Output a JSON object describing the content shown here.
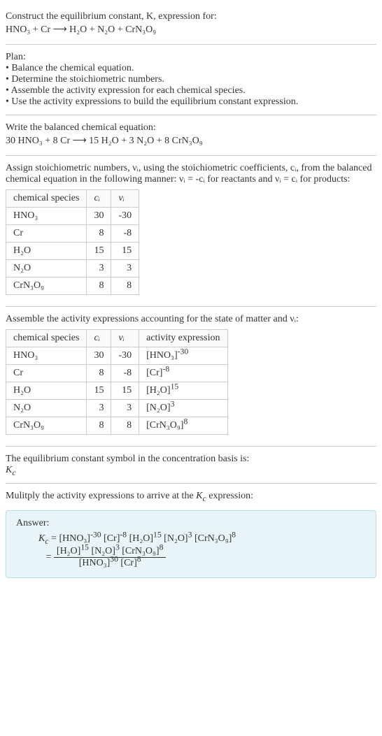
{
  "intro": {
    "line1": "Construct the equilibrium constant, K, expression for:",
    "equation": "HNO₃ + Cr ⟶ H₂O + N₂O + CrN₃O₉"
  },
  "plan": {
    "heading": "Plan:",
    "b1": "• Balance the chemical equation.",
    "b2": "• Determine the stoichiometric numbers.",
    "b3": "• Assemble the activity expression for each chemical species.",
    "b4": "• Use the activity expressions to build the equilibrium constant expression."
  },
  "balanced": {
    "heading": "Write the balanced chemical equation:",
    "equation": "30 HNO₃ + 8 Cr ⟶ 15 H₂O + 3 N₂O + 8 CrN₃O₉"
  },
  "assign": {
    "text": "Assign stoichiometric numbers, νᵢ, using the stoichiometric coefficients, cᵢ, from the balanced chemical equation in the following manner: νᵢ = -cᵢ for reactants and νᵢ = cᵢ for products:",
    "headers": {
      "h1": "chemical species",
      "h2": "cᵢ",
      "h3": "νᵢ"
    },
    "rows": [
      {
        "sp": "HNO₃",
        "c": "30",
        "v": "-30"
      },
      {
        "sp": "Cr",
        "c": "8",
        "v": "-8"
      },
      {
        "sp": "H₂O",
        "c": "15",
        "v": "15"
      },
      {
        "sp": "N₂O",
        "c": "3",
        "v": "3"
      },
      {
        "sp": "CrN₃O₉",
        "c": "8",
        "v": "8"
      }
    ]
  },
  "activity": {
    "text": "Assemble the activity expressions accounting for the state of matter and νᵢ:",
    "headers": {
      "h1": "chemical species",
      "h2": "cᵢ",
      "h3": "νᵢ",
      "h4": "activity expression"
    },
    "rows": [
      {
        "sp": "HNO₃",
        "c": "30",
        "v": "-30",
        "ae_base": "[HNO₃]",
        "ae_exp": "-30"
      },
      {
        "sp": "Cr",
        "c": "8",
        "v": "-8",
        "ae_base": "[Cr]",
        "ae_exp": "-8"
      },
      {
        "sp": "H₂O",
        "c": "15",
        "v": "15",
        "ae_base": "[H₂O]",
        "ae_exp": "15"
      },
      {
        "sp": "N₂O",
        "c": "3",
        "v": "3",
        "ae_base": "[N₂O]",
        "ae_exp": "3"
      },
      {
        "sp": "CrN₃O₉",
        "c": "8",
        "v": "8",
        "ae_base": "[CrN₃O₉]",
        "ae_exp": "8"
      }
    ]
  },
  "symbol": {
    "line1": "The equilibrium constant symbol in the concentration basis is:",
    "line2": "K_c"
  },
  "multiply": {
    "text": "Mulitply the activity expressions to arrive at the K_c expression:"
  },
  "answer": {
    "label": "Answer:",
    "kc": "K_c",
    "eq": "=",
    "flat": {
      "t1": "[HNO₃]",
      "e1": "-30",
      "t2": "[Cr]",
      "e2": "-8",
      "t3": "[H₂O]",
      "e3": "15",
      "t4": "[N₂O]",
      "e4": "3",
      "t5": "[CrN₃O₉]",
      "e5": "8"
    },
    "frac": {
      "num": {
        "t1": "[H₂O]",
        "e1": "15",
        "t2": "[N₂O]",
        "e2": "3",
        "t3": "[CrN₃O₉]",
        "e3": "8"
      },
      "den": {
        "t1": "[HNO₃]",
        "e1": "30",
        "t2": "[Cr]",
        "e2": "8"
      }
    }
  },
  "chart_data": {
    "type": "table",
    "tables": [
      {
        "title": "Stoichiometric numbers",
        "columns": [
          "chemical species",
          "c_i",
          "ν_i"
        ],
        "rows": [
          [
            "HNO3",
            30,
            -30
          ],
          [
            "Cr",
            8,
            -8
          ],
          [
            "H2O",
            15,
            15
          ],
          [
            "N2O",
            3,
            3
          ],
          [
            "CrN3O9",
            8,
            8
          ]
        ]
      },
      {
        "title": "Activity expressions",
        "columns": [
          "chemical species",
          "c_i",
          "ν_i",
          "activity expression"
        ],
        "rows": [
          [
            "HNO3",
            30,
            -30,
            "[HNO3]^-30"
          ],
          [
            "Cr",
            8,
            -8,
            "[Cr]^-8"
          ],
          [
            "H2O",
            15,
            15,
            "[H2O]^15"
          ],
          [
            "N2O",
            3,
            3,
            "[N2O]^3"
          ],
          [
            "CrN3O9",
            8,
            8,
            "[CrN3O9]^8"
          ]
        ]
      }
    ]
  }
}
